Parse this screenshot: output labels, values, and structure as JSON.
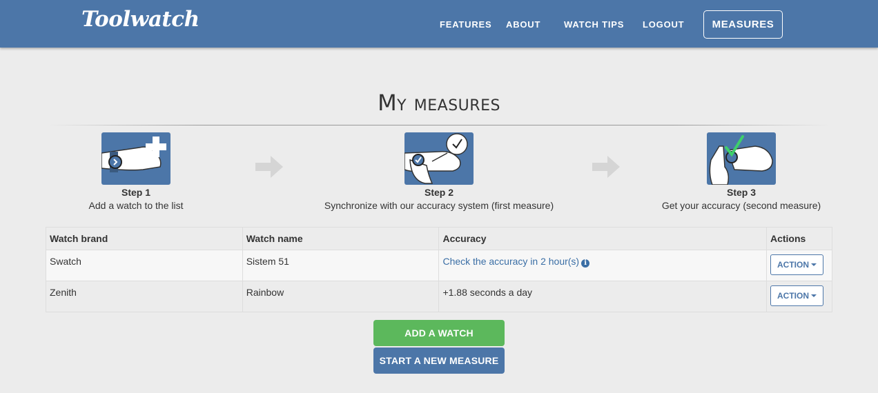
{
  "header": {
    "logo": "Toolwatch",
    "nav": {
      "features": "FEATURES",
      "about": "ABOUT",
      "watch_tips": "WATCH TIPS",
      "logout": "LOGOUT",
      "measures": "MEASURES"
    }
  },
  "page": {
    "title": "My measures"
  },
  "steps": [
    {
      "title": "Step 1",
      "description": "Add a watch to the list",
      "icon": "watch-add-icon"
    },
    {
      "title": "Step 2",
      "description": "Synchronize with our accuracy system (first measure)",
      "icon": "watch-sync-icon"
    },
    {
      "title": "Step 3",
      "description": "Get your accuracy (second measure)",
      "icon": "watch-check-icon"
    }
  ],
  "table": {
    "headers": {
      "brand": "Watch brand",
      "name": "Watch name",
      "accuracy": "Accuracy",
      "actions": "Actions"
    },
    "rows": [
      {
        "brand": "Swatch",
        "name": "Sistem 51",
        "accuracy": "Check the accuracy in 2 hour(s)",
        "action": "ACTION"
      },
      {
        "brand": "Zenith",
        "name": "Rainbow",
        "accuracy": "+1.88 seconds a day",
        "action": "ACTION"
      }
    ],
    "info_glyph": "i"
  },
  "buttons": {
    "add_watch": "ADD A WATCH",
    "start_measure": "START A NEW MEASURE"
  },
  "colors": {
    "primary": "#4c76a8",
    "success": "#5cb85c",
    "background": "#ececec",
    "link": "#3a6ea5"
  }
}
